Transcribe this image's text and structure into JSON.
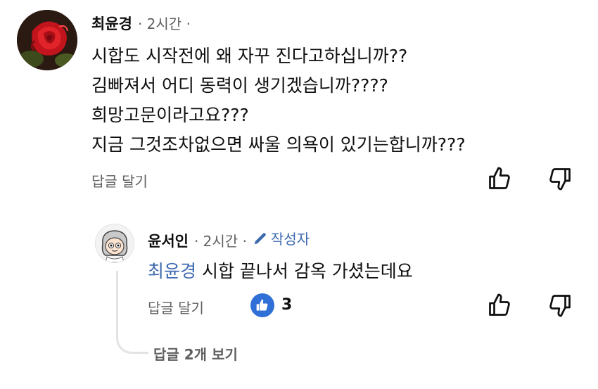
{
  "comment": {
    "author": "최윤경",
    "time": "· 2시간 ·",
    "lines": [
      "시합도 시작전에 왜 자꾸 진다고하십니까??",
      "김빠져서 어디 동력이 생기겠습니까????",
      "희망고문이라고요???",
      "지금 그것조차없으면 싸울 의욕이 있기는합니까???"
    ],
    "reply_label": "답글 달기",
    "avatar_icon": "rose-avatar",
    "like_icon": "thumbs-up-icon",
    "dislike_icon": "thumbs-down-icon"
  },
  "reply": {
    "author": "윤서인",
    "time": "· 2시간 ·",
    "creator_label": "작성자",
    "creator_icon": "pencil-icon",
    "mention": "최윤경",
    "text": " 시합 끝나서 감옥 가셨는데요",
    "reply_label": "답글 달기",
    "like_count": "3",
    "avatar_icon": "cartoon-avatar"
  },
  "more_replies": "답글 2개 보기",
  "colors": {
    "link_blue": "#3e6ab0",
    "like_badge": "#2f6fd6",
    "meta_gray": "#606060"
  }
}
